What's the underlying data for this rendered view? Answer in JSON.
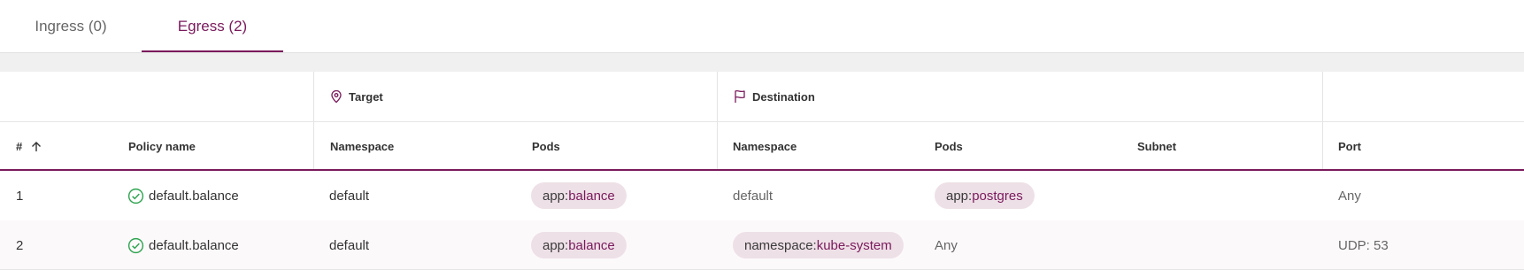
{
  "tabs": [
    {
      "label": "Ingress (0)",
      "active": false
    },
    {
      "label": "Egress (2)",
      "active": true
    }
  ],
  "table": {
    "groups": {
      "target": {
        "label": "Target",
        "icon": "location-pin-icon"
      },
      "destination": {
        "label": "Destination",
        "icon": "flag-icon"
      }
    },
    "columns": {
      "index": "#",
      "policy_name": "Policy name",
      "target_namespace": "Namespace",
      "target_pods": "Pods",
      "dest_namespace": "Namespace",
      "dest_pods": "Pods",
      "subnet": "Subnet",
      "port": "Port"
    },
    "sort_icon": "arrow-up-icon",
    "rows": [
      {
        "index": "1",
        "policy_name": "default.balance",
        "status_icon": "check-circle-icon",
        "target_namespace": "default",
        "target_pods": {
          "key": "app:",
          "value": "balance"
        },
        "dest_namespace": "default",
        "dest_pods": {
          "key": "app:",
          "value": "postgres"
        },
        "subnet": "",
        "port": "Any"
      },
      {
        "index": "2",
        "policy_name": "default.balance",
        "status_icon": "check-circle-icon",
        "target_namespace": "default",
        "target_pods": {
          "key": "app:",
          "value": "balance"
        },
        "dest_namespace": {
          "key": "namespace:",
          "value": "kube-system"
        },
        "dest_pods": "Any",
        "subnet": "",
        "port": "UDP: 53"
      }
    ]
  },
  "colors": {
    "accent": "#7a1a5c",
    "pill_bg": "#eee0e7",
    "success": "#2ea44f"
  }
}
